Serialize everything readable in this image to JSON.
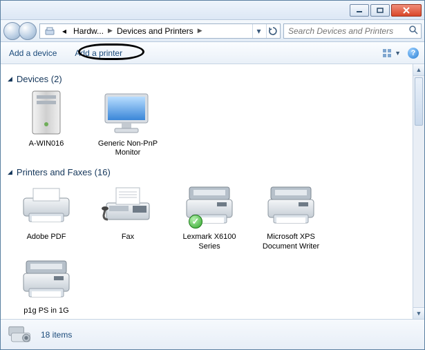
{
  "breadcrumb": {
    "icon": "control-panel",
    "items": [
      "Hardw...",
      "Devices and Printers"
    ]
  },
  "search": {
    "placeholder": "Search Devices and Printers"
  },
  "toolbar": {
    "add_device": "Add a device",
    "add_printer": "Add a printer"
  },
  "groups": [
    {
      "name": "Devices",
      "count": 2,
      "items": [
        {
          "label": "A-WIN016",
          "icon": "computer-tower"
        },
        {
          "label": "Generic Non-PnP Monitor",
          "icon": "monitor"
        }
      ]
    },
    {
      "name": "Printers and Faxes",
      "count": 16,
      "items": [
        {
          "label": "Adobe PDF",
          "icon": "printer-flat"
        },
        {
          "label": "Fax",
          "icon": "fax"
        },
        {
          "label": "Lexmark X6100 Series",
          "icon": "mfp",
          "default": true
        },
        {
          "label": "Microsoft XPS Document Writer",
          "icon": "mfp"
        },
        {
          "label": "p1g PS in 1G",
          "icon": "mfp"
        }
      ]
    }
  ],
  "status": {
    "count_label": "18 items"
  }
}
